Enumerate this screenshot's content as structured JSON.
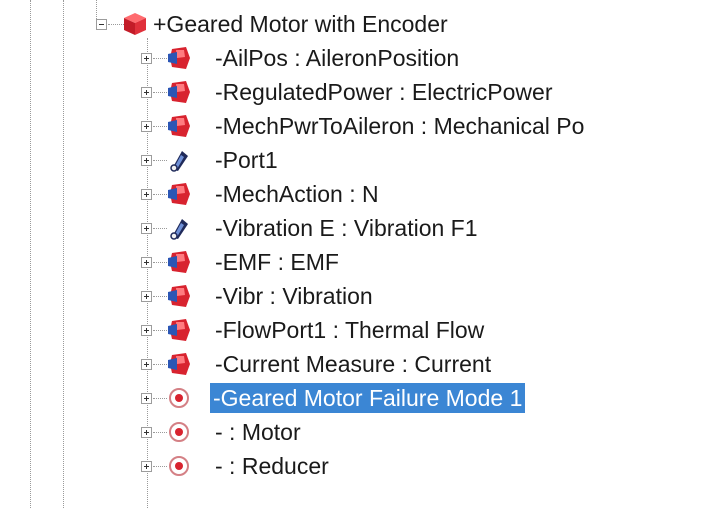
{
  "tree": {
    "root": {
      "label": "+Geared Motor with Encoder",
      "icon": "red-block-icon",
      "expanded": true
    },
    "children": [
      {
        "label": "-AilPos : AileronPosition",
        "icon": "red-block-icon"
      },
      {
        "label": "-RegulatedPower : ElectricPower",
        "icon": "red-block-icon"
      },
      {
        "label": "-MechPwrToAileron : Mechanical Po",
        "icon": "red-block-icon"
      },
      {
        "label": "-Port1",
        "icon": "port-icon"
      },
      {
        "label": "-MechAction : N",
        "icon": "red-block-icon"
      },
      {
        "label": "-Vibration E : Vibration F1",
        "icon": "port-icon"
      },
      {
        "label": "-EMF : EMF",
        "icon": "red-block-icon"
      },
      {
        "label": "-Vibr :  Vibration",
        "icon": "red-block-icon"
      },
      {
        "label": "-FlowPort1 : Thermal Flow",
        "icon": "red-block-icon"
      },
      {
        "label": "-Current Measure : Current",
        "icon": "red-block-icon"
      },
      {
        "label": "-Geared Motor Failure Mode 1",
        "icon": "failure-mode-icon",
        "selected": true
      },
      {
        "label": "- : Motor",
        "icon": "failure-mode-icon"
      },
      {
        "label": "- : Reducer",
        "icon": "failure-mode-icon"
      }
    ]
  },
  "colors": {
    "selection": "#3b86d4",
    "block": "#d8232f",
    "port": "#1f2a5a"
  }
}
